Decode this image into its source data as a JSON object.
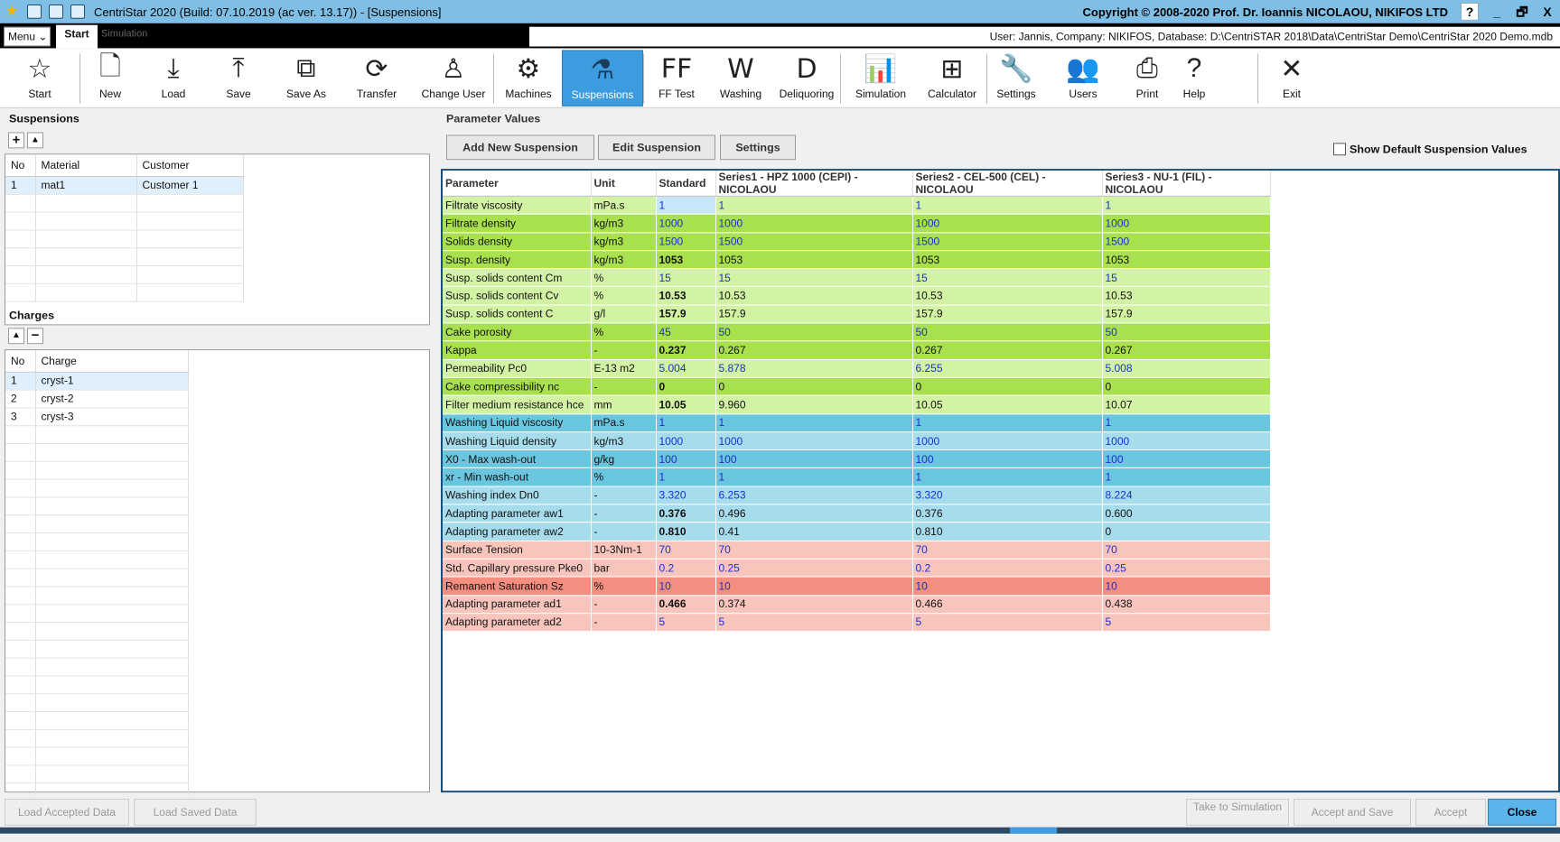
{
  "window": {
    "title": "CentriStar 2020 (Build: 07.10.2019 (ac ver. 13.17)) - [Suspensions]",
    "copyright": "Copyright © 2008-2020 Prof. Dr. Ioannis NICOLAOU, NIKIFOS LTD",
    "help": "?",
    "minimize": "_",
    "restore": "🗗",
    "close": "X"
  },
  "tabs": {
    "menu": "Menu",
    "start": "Start",
    "simulation": "Simulation"
  },
  "userinfo": "User: Jannis, Company: NIKIFOS, Database: D:\\CentriSTAR 2018\\Data\\CentriStar  Demo\\CentriStar 2020  Demo.mdb",
  "ribbon": [
    {
      "label": "Start",
      "icon": "star-icon",
      "glyph": "☆"
    },
    {
      "label": "New",
      "icon": "new-file-icon",
      "glyph": "🗋"
    },
    {
      "label": "Load",
      "icon": "load-icon",
      "glyph": "⤓"
    },
    {
      "label": "Save",
      "icon": "save-icon",
      "glyph": "⤒"
    },
    {
      "label": "Save As",
      "icon": "save-as-icon",
      "glyph": "⧉"
    },
    {
      "label": "Transfer",
      "icon": "transfer-icon",
      "glyph": "⟳"
    },
    {
      "label": "Change User",
      "icon": "change-user-icon",
      "glyph": "♙"
    },
    {
      "label": "Machines",
      "icon": "gear-icon",
      "glyph": "⚙"
    },
    {
      "label": "Suspensions",
      "icon": "flask-icon",
      "glyph": "⚗"
    },
    {
      "label": "FF Test",
      "icon": "ff-test-icon",
      "glyph": "FF"
    },
    {
      "label": "Washing",
      "icon": "washing-icon",
      "glyph": "W"
    },
    {
      "label": "Deliquoring",
      "icon": "deliquoring-icon",
      "glyph": "D"
    },
    {
      "label": "Simulation",
      "icon": "bar-chart-icon",
      "glyph": "📊"
    },
    {
      "label": "Calculator",
      "icon": "calculator-icon",
      "glyph": "⊞"
    },
    {
      "label": "Settings",
      "icon": "wrench-icon",
      "glyph": "🔧"
    },
    {
      "label": "Users",
      "icon": "users-icon",
      "glyph": "👥"
    },
    {
      "label": "Print",
      "icon": "printer-icon",
      "glyph": "⎙"
    },
    {
      "label": "Help",
      "icon": "help-icon",
      "glyph": "?"
    },
    {
      "label": "Exit",
      "icon": "close-icon",
      "glyph": "✕"
    }
  ],
  "suspensions": {
    "title": "Suspensions",
    "add": "+",
    "up": "▲",
    "headers": [
      "No",
      "Material",
      "Customer"
    ],
    "rows": [
      [
        "1",
        "mat1",
        "Customer 1"
      ]
    ]
  },
  "charges": {
    "title": "Charges",
    "up": "▲",
    "remove": "−",
    "headers": [
      "No",
      "Charge"
    ],
    "rows": [
      [
        "1",
        "cryst-1"
      ],
      [
        "2",
        "cryst-2"
      ],
      [
        "3",
        "cryst-3"
      ]
    ]
  },
  "params": {
    "title": "Parameter Values",
    "add": "Add New Suspension",
    "edit": "Edit Suspension",
    "settings": "Settings",
    "show_default": "Show Default Suspension Values",
    "headers": [
      "Parameter",
      "Unit",
      "Standard",
      "Series1 - HPZ 1000 (CEPI) - NICOLAOU",
      "Series2 - CEL-500 (CEL) - NICOLAOU",
      "Series3 - NU-1 (FIL) - NICOLAOU"
    ],
    "rows": [
      {
        "c": "c1",
        "b": "bl",
        "v": [
          "Filtrate viscosity",
          "mPa.s",
          "1",
          "1",
          "1",
          "1"
        ]
      },
      {
        "c": "c2",
        "b": "bl",
        "v": [
          "Filtrate density",
          "kg/m3",
          "1000",
          "1000",
          "1000",
          "1000"
        ]
      },
      {
        "c": "c2",
        "b": "bl",
        "v": [
          "Solids density",
          "kg/m3",
          "1500",
          "1500",
          "1500",
          "1500"
        ]
      },
      {
        "c": "c2",
        "b": "bd",
        "v": [
          "Susp. density",
          "kg/m3",
          "1053",
          "1053",
          "1053",
          "1053"
        ]
      },
      {
        "c": "c1",
        "b": "bl",
        "v": [
          "Susp. solids content Cm",
          "%",
          "15",
          "15",
          "15",
          "15"
        ]
      },
      {
        "c": "c1",
        "b": "bd",
        "v": [
          "Susp. solids content Cv",
          "%",
          "10.53",
          "10.53",
          "10.53",
          "10.53"
        ]
      },
      {
        "c": "c1",
        "b": "bd",
        "v": [
          "Susp. solids content C",
          "g/l",
          "157.9",
          "157.9",
          "157.9",
          "157.9"
        ]
      },
      {
        "c": "c2",
        "b": "bl",
        "v": [
          "Cake porosity",
          "%",
          "45",
          "50",
          "50",
          "50"
        ]
      },
      {
        "c": "c2",
        "b": "bd",
        "v": [
          "Kappa",
          "-",
          "0.237",
          "0.267",
          "0.267",
          "0.267"
        ]
      },
      {
        "c": "c1",
        "b": "bl",
        "v": [
          "Permeability Pc0",
          "E-13 m2",
          "5.004",
          "5.878",
          "6.255",
          "5.008"
        ]
      },
      {
        "c": "c2",
        "b": "bd",
        "v": [
          "Cake compressibility nc",
          "-",
          "0",
          "0",
          "0",
          "0"
        ]
      },
      {
        "c": "c1",
        "b": "bd",
        "v": [
          "Filter medium resistance hce",
          "mm",
          "10.05",
          "9.960",
          "10.05",
          "10.07"
        ]
      },
      {
        "c": "c4",
        "b": "bl",
        "v": [
          "Washing Liquid viscosity",
          "mPa.s",
          "1",
          "1",
          "1",
          "1"
        ]
      },
      {
        "c": "c3",
        "b": "bl",
        "v": [
          "Washing Liquid density",
          "kg/m3",
          "1000",
          "1000",
          "1000",
          "1000"
        ]
      },
      {
        "c": "c4",
        "b": "bl",
        "v": [
          "X0 - Max wash-out",
          "g/kg",
          "100",
          "100",
          "100",
          "100"
        ]
      },
      {
        "c": "c4",
        "b": "bl",
        "v": [
          "xr - Min wash-out",
          "%",
          "1",
          "1",
          "1",
          "1"
        ]
      },
      {
        "c": "c3",
        "b": "bl",
        "v": [
          "Washing index Dn0",
          "-",
          "3.320",
          "6.253",
          "3.320",
          "8.224"
        ]
      },
      {
        "c": "c3",
        "b": "bd",
        "v": [
          "Adapting parameter aw1",
          "-",
          "0.376",
          "0.496",
          "0.376",
          "0.600"
        ]
      },
      {
        "c": "c3",
        "b": "bd",
        "v": [
          "Adapting parameter aw2",
          "-",
          "0.810",
          "0.41",
          "0.810",
          "0"
        ]
      },
      {
        "c": "c5",
        "b": "bl",
        "v": [
          "Surface Tension",
          "10-3Nm-1",
          "70",
          "70",
          "70",
          "70"
        ]
      },
      {
        "c": "c5",
        "b": "bl",
        "v": [
          "Std. Capillary pressure Pke0",
          "bar",
          "0.2",
          "0.25",
          "0.2",
          "0.25"
        ]
      },
      {
        "c": "c6",
        "b": "bl",
        "v": [
          "Remanent Saturation Sz",
          "%",
          "10",
          "10",
          "10",
          "10"
        ]
      },
      {
        "c": "c5",
        "b": "bd",
        "v": [
          "Adapting parameter ad1",
          "-",
          "0.466",
          "0.374",
          "0.466",
          "0.438"
        ]
      },
      {
        "c": "c5",
        "b": "bl",
        "v": [
          "Adapting parameter ad2",
          "-",
          "5",
          "5",
          "5",
          "5"
        ]
      }
    ]
  },
  "bottom": {
    "load_accepted": "Load Accepted Data",
    "load_saved": "Load Saved Data",
    "take_to_sim": "Take to Simulation",
    "accept_save": "Accept and Save",
    "accept": "Accept",
    "close": "Close"
  }
}
